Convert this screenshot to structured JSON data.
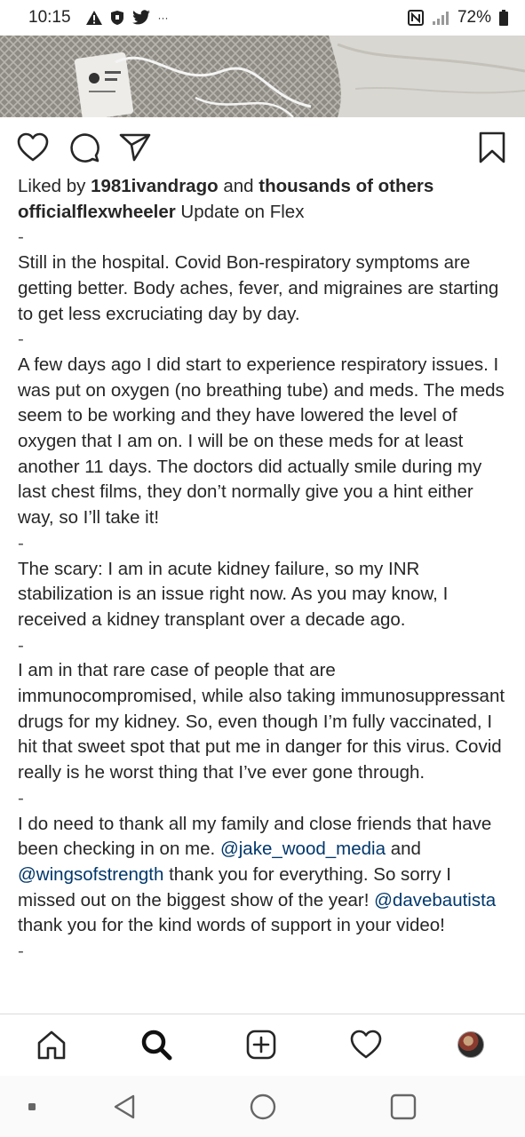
{
  "status_bar": {
    "time": "10:15",
    "overflow": "···",
    "battery_percent": "72%",
    "icons": [
      "warning-icon",
      "shield-icon",
      "twitter-icon",
      "nfc-icon",
      "signal-icon",
      "battery-icon"
    ]
  },
  "post": {
    "liked_by_prefix": "Liked by ",
    "liked_by_user": "1981ivandrago",
    "liked_by_middle": " and ",
    "liked_by_others": "thousands of others",
    "author": "officialflexwheeler",
    "caption_title": " Update on Flex",
    "sep": "-",
    "para1": "Still in the hospital.  Covid Bon-respiratory symptoms are getting better.  Body aches, fever, and migraines are starting to get less excruciating day by day.",
    "para2": "A few days ago I did start to experience respiratory issues.  I was put on oxygen (no breathing tube) and meds.  The meds seem to be working and they have lowered the level of oxygen that I am on.  I will be on these meds for at least another 11 days.  The doctors did actually smile during my last chest films, they don’t normally give you a hint either way, so I’ll take it!",
    "para3": "The scary: I am in acute kidney failure, so my INR stabilization is an issue right now.  As you may know, I received a kidney transplant over a decade ago.",
    "para4": "I am in that rare case of people that are immunocompromised, while also taking immunosuppressant drugs for my kidney.  So, even though I’m fully vaccinated, I hit that sweet spot that put me in danger for this virus.  Covid really is he worst thing that I’ve ever gone through.",
    "para5_a": "I do need to thank all my family and close friends that have been checking in on me.  ",
    "mention1": "@jake_wood_media",
    "para5_b": " and ",
    "mention2": "@wingsofstrength",
    "para5_c": " thank you for everything.  So sorry I missed out on the biggest show of the year! ",
    "mention3": "@davebautista",
    "para5_d": " thank you for the kind words of support in your video!"
  },
  "actions": [
    "heart-icon",
    "comment-icon",
    "share-icon",
    "bookmark-icon"
  ],
  "bottom_nav": [
    "home-icon",
    "search-icon",
    "add-post-icon",
    "activity-heart-icon",
    "profile-avatar"
  ],
  "system_nav": [
    "recents-dot",
    "back-icon",
    "home-circle-icon",
    "overview-square-icon"
  ]
}
